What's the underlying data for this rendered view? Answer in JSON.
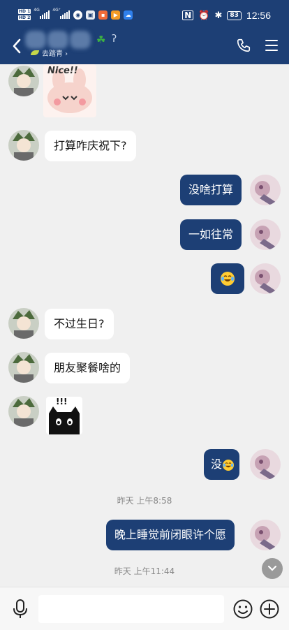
{
  "status_bar": {
    "network": "4G",
    "network2": "4G⁺",
    "battery": "83",
    "time": "12:56"
  },
  "header": {
    "subtitle": "去踏青 ›",
    "icons": [
      "back-arrow-icon",
      "phone-icon",
      "menu-icon"
    ]
  },
  "messages": [
    {
      "side": "left",
      "type": "sticker",
      "sticker": "nice-bunny-sticker",
      "text": "Nice!!"
    },
    {
      "side": "left",
      "type": "text",
      "text": "打算咋庆祝下?"
    },
    {
      "side": "right",
      "type": "text",
      "text": "没啥打算"
    },
    {
      "side": "right",
      "type": "text",
      "text": "一如往常"
    },
    {
      "side": "right",
      "type": "emoji",
      "emoji": "laughing-tears-emoji"
    },
    {
      "side": "left",
      "type": "text",
      "text": "不过生日?"
    },
    {
      "side": "left",
      "type": "text",
      "text": "朋友聚餐啥的"
    },
    {
      "side": "left",
      "type": "sticker",
      "sticker": "black-cat-sticker",
      "text": "!!!"
    },
    {
      "side": "right",
      "type": "text",
      "text": "没"
    },
    {
      "side": "right",
      "type": "text",
      "text": "晚上睡觉前闭眼许个愿"
    }
  ],
  "timestamps": [
    "昨天 上午8:58",
    "昨天 上午11:44"
  ],
  "input_bar": {
    "placeholder": "",
    "icons": [
      "microphone-icon",
      "smiley-icon",
      "plus-icon"
    ]
  },
  "colors": {
    "header_bg": "#1d3f75",
    "outgoing_bubble": "#1d3f75",
    "incoming_bubble": "#ffffff",
    "chat_bg": "#f0f0f0"
  }
}
